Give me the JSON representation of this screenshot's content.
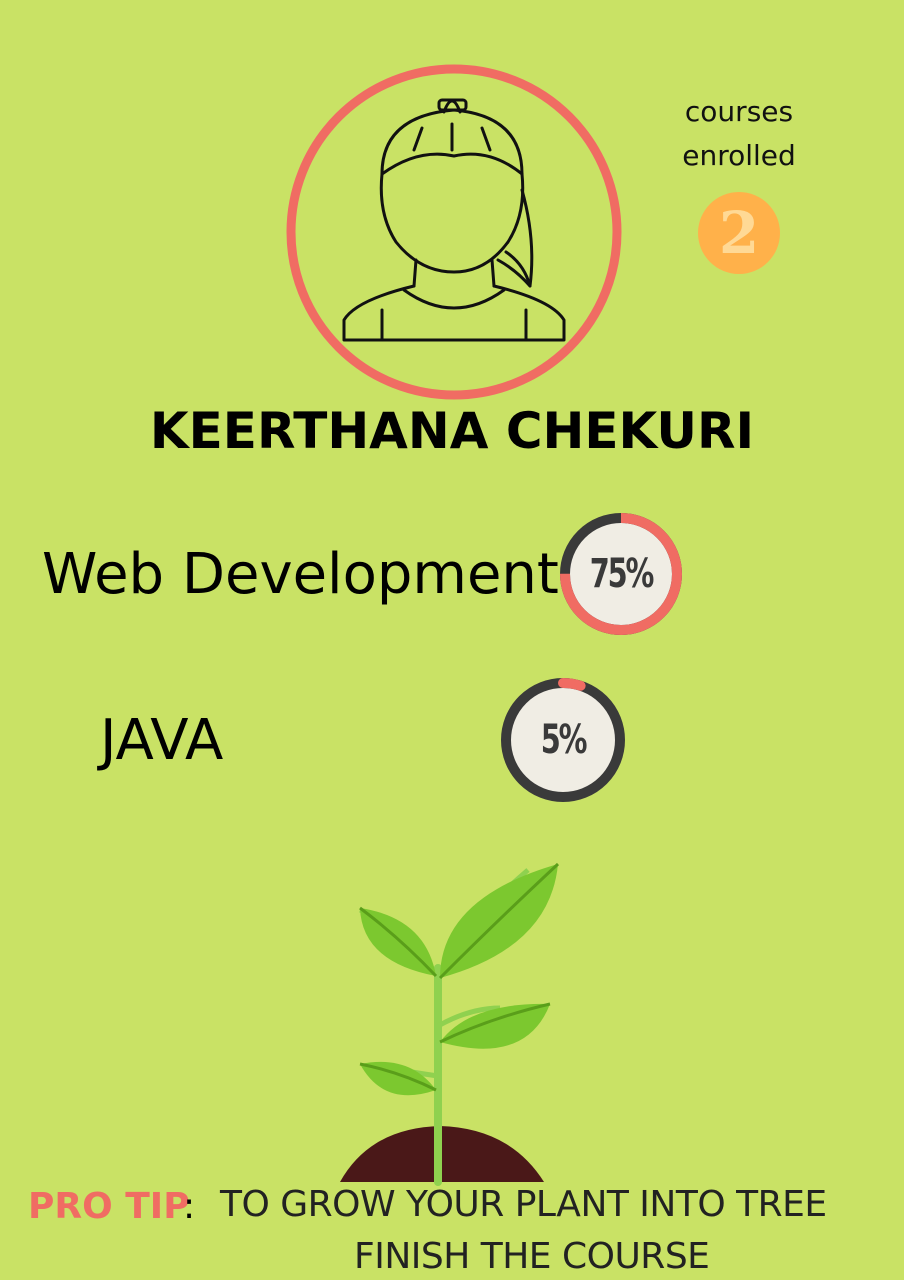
{
  "profile": {
    "name": "KEERTHANA CHEKURI",
    "avatar_icon": "female-user-avatar-icon"
  },
  "enrollment": {
    "label_line1": "courses",
    "label_line2": "enrolled",
    "count": "2"
  },
  "courses": [
    {
      "title": "Web Development",
      "progress_label": "75%",
      "progress": 0.75
    },
    {
      "title": "JAVA",
      "progress_label": "5%",
      "progress": 0.05
    }
  ],
  "plant": {
    "icon": "sprout-plant-icon"
  },
  "protip": {
    "label": "PRO TIP",
    "colon": ":",
    "line1": "TO GROW YOUR  PLANT INTO TREE",
    "line2": "FINISH THE COURSE"
  },
  "colors": {
    "background": "#c9e265",
    "accent": "#f06c63",
    "gauge_track": "#3a3a3a",
    "gauge_face": "#f0ede4",
    "badge": "#ffb14a"
  }
}
